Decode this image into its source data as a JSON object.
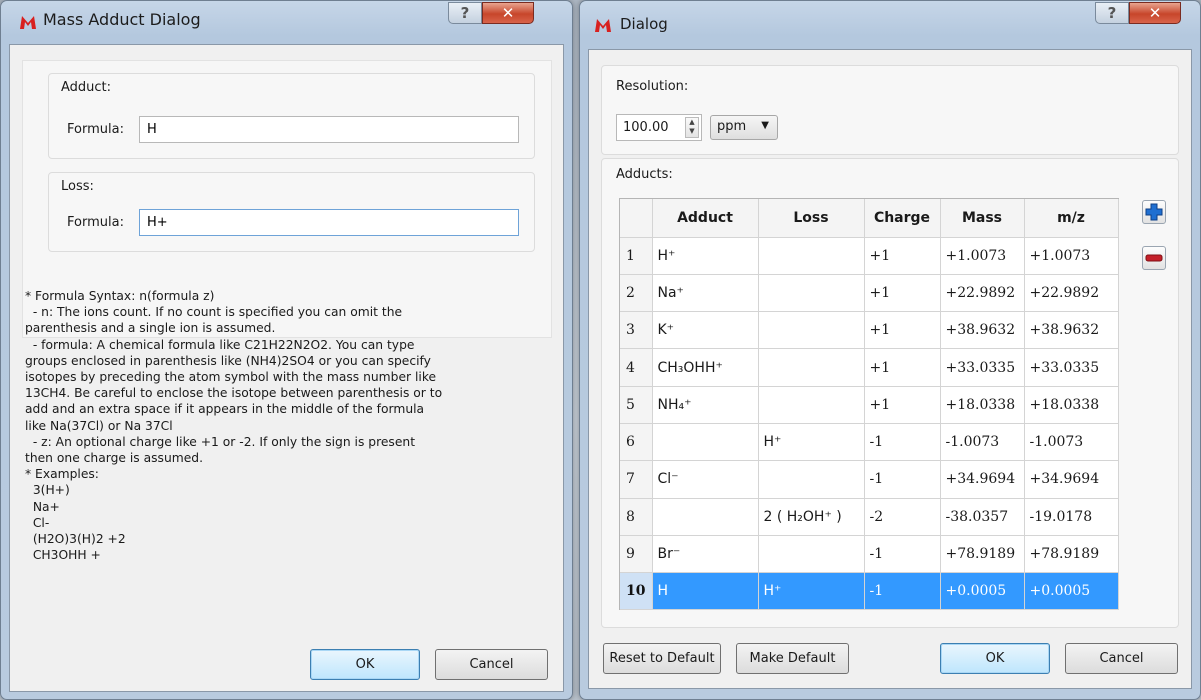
{
  "mass_dialog": {
    "title": "Mass Adduct Dialog",
    "adduct_group": "Adduct:",
    "adduct_formula_label": "Formula:",
    "adduct_formula_value": "H",
    "loss_group": "Loss:",
    "loss_formula_label": "Formula:",
    "loss_formula_value": "H+",
    "help_text": "* Formula Syntax: n(formula z)\n  - n: The ions count. If no count is specified you can omit the\nparenthesis and a single ion is assumed.\n  - formula: A chemical formula like C21H22N2O2. You can type\ngroups enclosed in parenthesis like (NH4)2SO4 or you can specify\nisotopes by preceding the atom symbol with the mass number like\n13CH4. Be careful to enclose the isotope between parenthesis or to\nadd and an extra space if it appears in the middle of the formula\nlike Na(37Cl) or Na 37Cl\n  - z: An optional charge like +1 or -2. If only the sign is present\nthen one charge is assumed.\n* Examples:\n  3(H+)\n  Na+\n  Cl-\n  (H2O)3(H)2 +2\n  CH3OHH +",
    "ok_label": "OK",
    "cancel_label": "Cancel"
  },
  "adduct_dialog": {
    "title": "Dialog",
    "resolution_label": "Resolution:",
    "resolution_value": "100.00",
    "resolution_unit": "ppm",
    "adducts_label": "Adducts:",
    "columns": [
      "Adduct",
      "Loss",
      "Charge",
      "Mass",
      "m/z"
    ],
    "rows": [
      {
        "n": "1",
        "adduct": "H⁺",
        "loss": "",
        "charge": "+1",
        "mass": "+1.0073",
        "mz": "+1.0073"
      },
      {
        "n": "2",
        "adduct": "Na⁺",
        "loss": "",
        "charge": "+1",
        "mass": "+22.9892",
        "mz": "+22.9892"
      },
      {
        "n": "3",
        "adduct": "K⁺",
        "loss": "",
        "charge": "+1",
        "mass": "+38.9632",
        "mz": "+38.9632"
      },
      {
        "n": "4",
        "adduct": "CH₃OHH⁺",
        "loss": "",
        "charge": "+1",
        "mass": "+33.0335",
        "mz": "+33.0335"
      },
      {
        "n": "5",
        "adduct": "NH₄⁺",
        "loss": "",
        "charge": "+1",
        "mass": "+18.0338",
        "mz": "+18.0338"
      },
      {
        "n": "6",
        "adduct": "",
        "loss": "H⁺",
        "charge": "-1",
        "mass": "-1.0073",
        "mz": "-1.0073"
      },
      {
        "n": "7",
        "adduct": "Cl⁻",
        "loss": "",
        "charge": "-1",
        "mass": "+34.9694",
        "mz": "+34.9694"
      },
      {
        "n": "8",
        "adduct": "",
        "loss": "2 ( H₂OH⁺ )",
        "charge": "-2",
        "mass": "-38.0357",
        "mz": "-19.0178"
      },
      {
        "n": "9",
        "adduct": "Br⁻",
        "loss": "",
        "charge": "-1",
        "mass": "+78.9189",
        "mz": "+78.9189"
      },
      {
        "n": "10",
        "adduct": "H",
        "loss": "H⁺",
        "charge": "-1",
        "mass": "+0.0005",
        "mz": "+0.0005"
      }
    ],
    "selected_row": "10",
    "add_icon": "plus-icon",
    "remove_icon": "minus-icon",
    "reset_label": "Reset to Default",
    "make_default_label": "Make Default",
    "ok_label": "OK",
    "cancel_label": "Cancel"
  },
  "colors": {
    "selection": "#3399ff",
    "close_button": "#c7462b",
    "add_icon": "#1f6fd1",
    "remove_icon": "#c4202a"
  }
}
